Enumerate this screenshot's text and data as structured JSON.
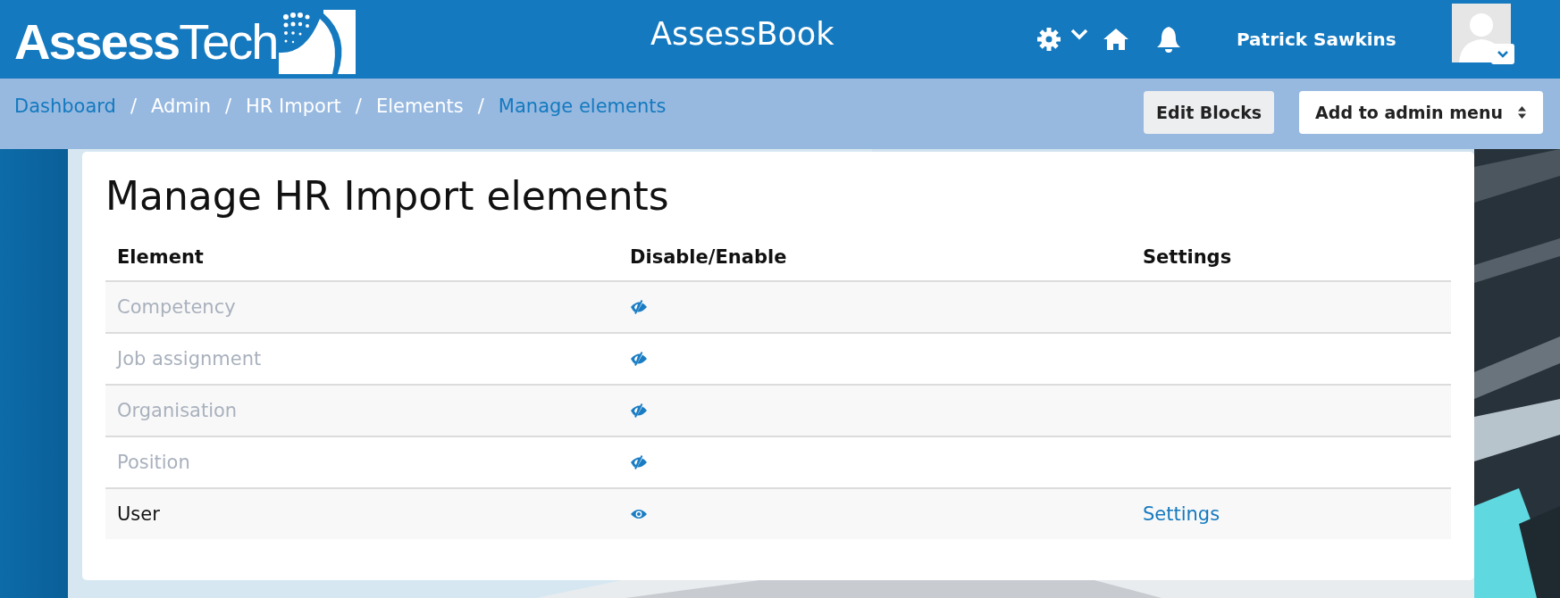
{
  "header": {
    "logo": "**Assess**Tech",
    "site_name": "AssessBook",
    "user_name": "Patrick Sawkins"
  },
  "breadcrumb": [
    {
      "label": "Dashboard",
      "kind": "link"
    },
    {
      "label": "/",
      "kind": "separator"
    },
    {
      "label": "Admin",
      "kind": "text"
    },
    {
      "label": "/",
      "kind": "separator"
    },
    {
      "label": "HR Import",
      "kind": "text"
    },
    {
      "label": "/",
      "kind": "separator"
    },
    {
      "label": "Elements",
      "kind": "text"
    },
    {
      "label": "/",
      "kind": "separator"
    },
    {
      "label": "Manage elements",
      "kind": "current"
    }
  ],
  "buttons": [
    {
      "label": "Edit Blocks",
      "kind": "plain"
    },
    {
      "label": "Add to admin menu",
      "kind": "select"
    }
  ],
  "page_title": "Manage HR Import elements",
  "table": {
    "columns": [
      "Element",
      "Disable/Enable",
      "Settings"
    ],
    "rows": [
      {
        "element": "Competency",
        "enabled": false
      },
      {
        "element": "Job assignment",
        "enabled": false
      },
      {
        "element": "Organisation",
        "enabled": false
      },
      {
        "element": "Position",
        "enabled": false
      },
      {
        "element": "User",
        "enabled": true,
        "settings": "Settings"
      }
    ]
  }
}
